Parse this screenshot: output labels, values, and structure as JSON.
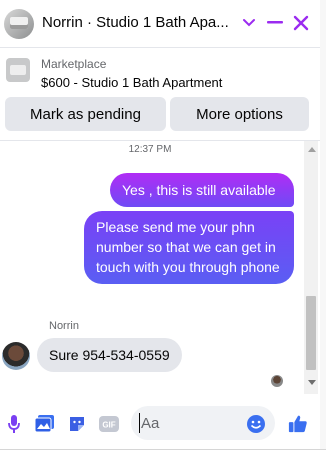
{
  "header": {
    "title": "Norrin · Studio 1 Bath Apa...",
    "accent": "#9b2bf0"
  },
  "marketplace": {
    "label": "Marketplace",
    "item": "$600 - Studio 1 Bath Apartment",
    "buttons": {
      "pending": "Mark as pending",
      "more": "More options"
    }
  },
  "chat": {
    "timestamp": "12:37 PM",
    "messages": [
      {
        "from": "me",
        "text": "Yes , this is still available"
      },
      {
        "from": "me",
        "text": "Please send me your phn number so that we can get in touch with you through phone"
      },
      {
        "from": "Norrin",
        "sender_label": "Norrin",
        "text": "Sure 954-534-0559"
      }
    ]
  },
  "composer": {
    "placeholder": "Aa"
  },
  "icons": [
    "chevron-down-icon",
    "minimize-icon",
    "close-icon",
    "microphone-icon",
    "photo-icon",
    "sticker-icon",
    "gif-icon",
    "emoji-icon",
    "thumbs-up-icon"
  ]
}
